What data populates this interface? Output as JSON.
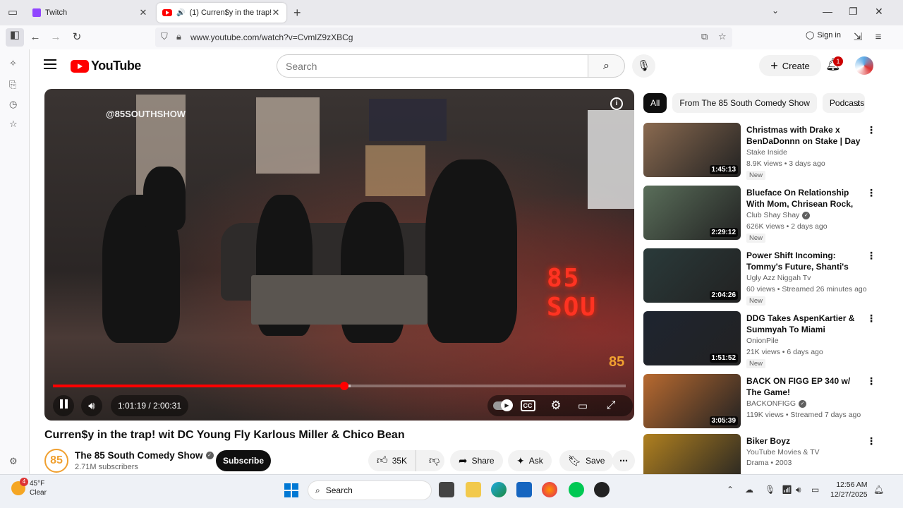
{
  "browser": {
    "tabs": [
      {
        "label": "Twitch"
      },
      {
        "label": "(1) Curren$y in the trap! wit",
        "speaker": "🔊"
      }
    ],
    "url": "www.youtube.com/watch?v=CvmlZ9zXBCg",
    "sign_in": "Sign in"
  },
  "yt": {
    "logo_text": "YouTube",
    "search_placeholder": "Search",
    "create_label": "Create",
    "notification_count": "1"
  },
  "player": {
    "watermark": "@85SOUTHSHOW",
    "overlay_sign": "85 SOU",
    "corner_logo": "85",
    "current_time": "1:01:19",
    "duration": "2:00:31",
    "time_display": "1:01:19 / 2:00:31",
    "progress_fraction": 0.509,
    "buffered_fraction": 0.52
  },
  "video": {
    "title": "Curren$y in the trap! wit DC Young Fly Karlous Miller & Chico Bean",
    "channel": "The 85 South Comedy Show",
    "channel_avatar_text": "85",
    "subscribers": "2.71M subscribers",
    "subscribe_label": "Subscribe",
    "likes": "35K",
    "share_label": "Share",
    "ask_label": "Ask",
    "save_label": "Save"
  },
  "chips": [
    "All",
    "From The 85 South Comedy Show",
    "Podcasts"
  ],
  "recommendations": [
    {
      "title": "Christmas with Drake x BenDaDonnn on Stake | Day 2",
      "channel": "Stake Inside",
      "verified": false,
      "meta": "8.9K views • 3 days ago",
      "badge": "New",
      "duration": "1:45:13",
      "thumb": "#8a6a50"
    },
    {
      "title": "Blueface On Relationship With Mom, Chrisean Rock, Kids, ...",
      "channel": "Club Shay Shay",
      "verified": true,
      "meta": "626K views • 2 days ago",
      "badge": "New",
      "duration": "2:29:12",
      "thumb": "#5a6e5a"
    },
    {
      "title": "Power Shift Incoming: Tommy's Future, Shanti's Motive & A ...",
      "channel": "Ugly Azz Niggah Tv",
      "verified": false,
      "meta": "60 views • Streamed 26 minutes ago",
      "badge": "New",
      "duration": "2:04:26",
      "thumb": "#2a3a3a"
    },
    {
      "title": "DDG Takes AspenKartier & Summyah To Miami",
      "channel": "OnionPile",
      "verified": false,
      "meta": "21K views • 6 days ago",
      "badge": "New",
      "duration": "1:51:52",
      "thumb": "#1e2430"
    },
    {
      "title": "BACK ON FIGG EP 340 w/ The Game!",
      "channel": "BACKONFIGG",
      "verified": true,
      "meta": "119K views • Streamed 7 days ago",
      "badge": "",
      "duration": "3:05:39",
      "thumb": "#b86a30"
    },
    {
      "title": "Biker Boyz",
      "channel": "YouTube Movies & TV",
      "verified": false,
      "meta": "Drama • 2003",
      "badge": "",
      "duration": "",
      "thumb": "#b08020"
    }
  ],
  "taskbar": {
    "temperature": "45°F",
    "condition": "Clear",
    "weather_badge": "4",
    "search_label": "Search",
    "time": "12:56 AM",
    "date": "12/27/2025"
  }
}
